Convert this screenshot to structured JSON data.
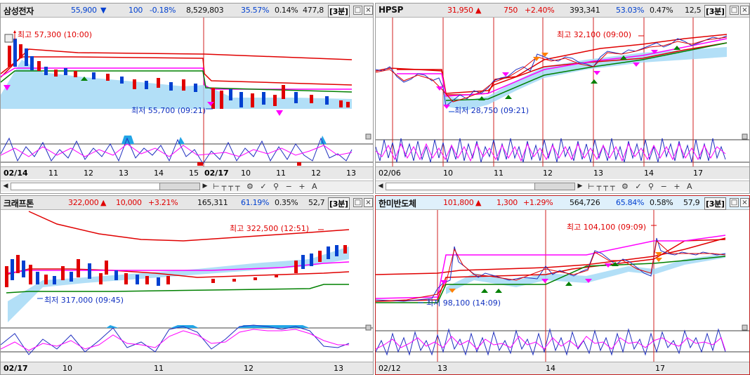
{
  "panes": [
    {
      "name": "삼성전자",
      "price": "55,900",
      "price_dir": "▼",
      "change": "100",
      "rate": "-0.18%",
      "volume": "8,529,803",
      "vol_ratio": "35.57%",
      "turnover": "0.14%",
      "extra": "477,8",
      "interval": "[3분]",
      "high_label": "최고 57,300 (10:00)",
      "low_label": "최저 55,700 (09:21)",
      "x_labels": [
        "02/14",
        "11",
        "12",
        "13",
        "14",
        "15",
        "02/17",
        "10",
        "11",
        "12",
        "13"
      ]
    },
    {
      "name": "HPSP",
      "price": "31,950",
      "price_dir": "▲",
      "change": "750",
      "rate": "+2.40%",
      "volume": "393,341",
      "vol_ratio": "53.03%",
      "turnover": "0.47%",
      "extra": "12,5",
      "interval": "[3분]",
      "high_label": "최고 32,100 (09:00)",
      "low_label": "최저 28,750 (09:21)",
      "x_labels": [
        "02/06",
        "10",
        "11",
        "12",
        "13",
        "14",
        "17"
      ]
    },
    {
      "name": "크래프톤",
      "price": "322,000",
      "price_dir": "▲",
      "change": "10,000",
      "rate": "+3.21%",
      "volume": "165,311",
      "vol_ratio": "61.19%",
      "turnover": "0.35%",
      "extra": "52,7",
      "interval": "[3분]",
      "high_label": "최고 322,500 (12:51)",
      "low_label": "최저 317,000 (09:45)",
      "x_labels": [
        "02/17",
        "10",
        "11",
        "12",
        "13"
      ]
    },
    {
      "name": "한미반도체",
      "price": "101,800",
      "price_dir": "▲",
      "change": "1,300",
      "rate": "+1.29%",
      "volume": "564,726",
      "vol_ratio": "65.84%",
      "turnover": "0.58%",
      "extra": "57,9",
      "interval": "[3분]",
      "high_label": "최고 104,100 (09:09)",
      "low_label": "최저 98,100 (14:09)",
      "x_labels": [
        "02/12",
        "13",
        "14",
        "17"
      ]
    }
  ],
  "window_buttons": {
    "restore": "□",
    "close": "×"
  },
  "scroll": {
    "left": "◀",
    "right": "▶"
  },
  "tool_icons": [
    "zoom-slider-icon",
    "settings-icon",
    "indicator-icon",
    "chart-type-icon",
    "crosshair-icon",
    "magnifier-icon"
  ],
  "tool_glyphs": {
    "zoom_out": "−",
    "zoom_in": "+",
    "text": "A"
  },
  "colors": {
    "up": "#e00000",
    "down": "#0040d0",
    "ma_red": "#e00000",
    "ma_magenta": "#ff00ff",
    "ma_green": "#008000",
    "band": "#9fd7f5"
  }
}
